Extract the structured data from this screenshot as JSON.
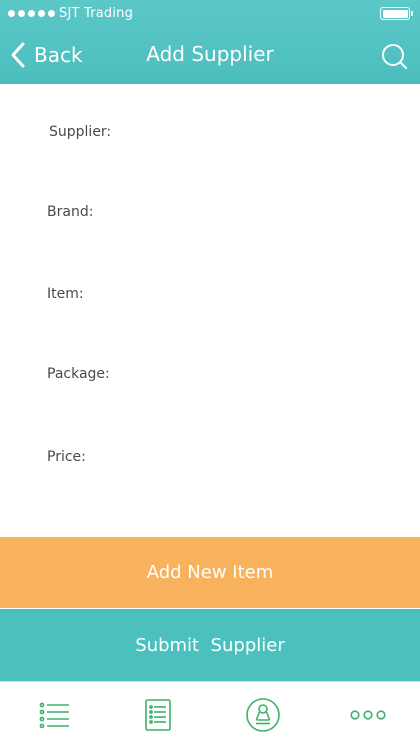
{
  "status_bar": {
    "carrier": "SJT Trading",
    "signal_dots": 5,
    "battery_level": 1.0
  },
  "nav": {
    "back_label": "Back",
    "title": "Add Supplier",
    "back_icon": "chevron-left-icon",
    "search_icon": "search-icon"
  },
  "form": {
    "fields": [
      {
        "label": "Supplier:"
      },
      {
        "label": "Brand:"
      },
      {
        "label": "Item:"
      },
      {
        "label": "Package:"
      },
      {
        "label": "Price:"
      }
    ]
  },
  "actions": {
    "add_item_label": "Add New Item",
    "submit_label": "Submit  Supplier"
  },
  "tabbar": {
    "tabs": [
      {
        "icon": "list-icon"
      },
      {
        "icon": "document-icon"
      },
      {
        "icon": "stamp-icon"
      },
      {
        "icon": "more-icon"
      }
    ]
  },
  "colors": {
    "header": "#4cbdbd",
    "accent_orange": "#f8b25d",
    "accent_teal": "#4cbfbf",
    "tab_icon": "#3fb16a"
  }
}
